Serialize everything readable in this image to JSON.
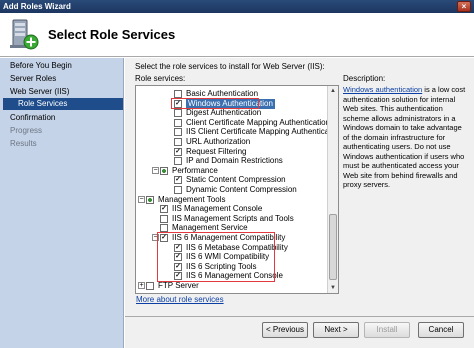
{
  "window": {
    "title": "Add Roles Wizard",
    "close_glyph": "×"
  },
  "header": {
    "title": "Select Role Services",
    "icon": "server-add-icon"
  },
  "nav": {
    "items": [
      {
        "label": "Before You Begin",
        "state": "normal"
      },
      {
        "label": "Server Roles",
        "state": "normal"
      },
      {
        "label": "Web Server (IIS)",
        "state": "normal"
      },
      {
        "label": "Role Services",
        "state": "selected"
      },
      {
        "label": "Confirmation",
        "state": "normal"
      },
      {
        "label": "Progress",
        "state": "disabled"
      },
      {
        "label": "Results",
        "state": "disabled"
      }
    ]
  },
  "main": {
    "instruction": "Select the role services to install for Web Server (IIS):",
    "role_services_label": "Role services:",
    "description_label": "Description:",
    "tree": [
      {
        "label": "Basic Authentication",
        "checked": false,
        "level": 3
      },
      {
        "label": "Windows Authentication",
        "checked": true,
        "level": 3,
        "selected": true
      },
      {
        "label": "Digest Authentication",
        "checked": false,
        "level": 3
      },
      {
        "label": "Client Certificate Mapping Authentication",
        "checked": false,
        "level": 3
      },
      {
        "label": "IIS Client Certificate Mapping Authentication",
        "checked": false,
        "level": 3
      },
      {
        "label": "URL Authorization",
        "checked": false,
        "level": 3
      },
      {
        "label": "Request Filtering",
        "checked": true,
        "level": 3
      },
      {
        "label": "IP and Domain Restrictions",
        "checked": false,
        "level": 3
      },
      {
        "label": "Performance",
        "checked": "partial",
        "level": 2,
        "expander": "−"
      },
      {
        "label": "Static Content Compression",
        "checked": true,
        "level": 3
      },
      {
        "label": "Dynamic Content Compression",
        "checked": false,
        "level": 3
      },
      {
        "label": "Management Tools",
        "checked": "partial",
        "level": 1,
        "expander": "−"
      },
      {
        "label": "IIS Management Console",
        "checked": true,
        "level": 2
      },
      {
        "label": "IIS Management Scripts and Tools",
        "checked": false,
        "level": 2
      },
      {
        "label": "Management Service",
        "checked": false,
        "level": 2
      },
      {
        "label": "IIS 6 Management Compatibility",
        "checked": true,
        "level": 2,
        "expander": "−"
      },
      {
        "label": "IIS 6 Metabase Compatibility",
        "checked": true,
        "level": 3
      },
      {
        "label": "IIS 6 WMI Compatibility",
        "checked": true,
        "level": 3
      },
      {
        "label": "IIS 6 Scripting Tools",
        "checked": true,
        "level": 3
      },
      {
        "label": "IIS 6 Management Console",
        "checked": true,
        "level": 3
      },
      {
        "label": "FTP Server",
        "checked": false,
        "level": 1,
        "expander": "+"
      }
    ],
    "more_link": "More about role services",
    "description": {
      "link_text": "Windows authentication",
      "text": " is a low cost authentication solution for internal Web sites. This authentication scheme allows administrators in a Windows domain to take advantage of the domain infrastructure for authenticating users. Do not use Windows authentication if users who must be authenticated access your Web site from behind firewalls and proxy servers."
    }
  },
  "buttons": {
    "previous": "< Previous",
    "next": "Next >",
    "install": "Install",
    "cancel": "Cancel"
  },
  "colors": {
    "title_bar": "#1c3660",
    "nav_background": "#c4d3e8",
    "nav_selected": "#1f4d8c",
    "highlight_box": "#e0393e",
    "link": "#0b3fa3"
  }
}
